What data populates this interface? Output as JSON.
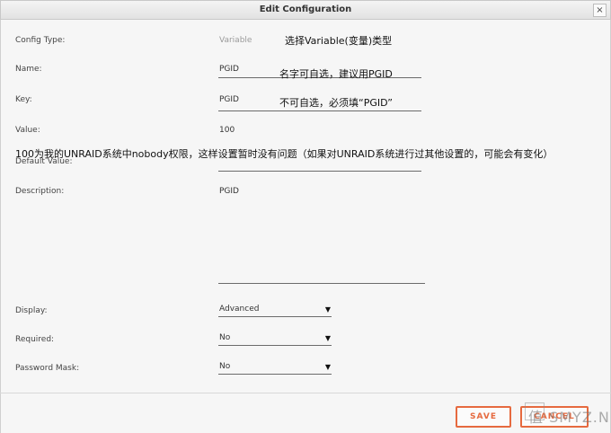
{
  "window": {
    "title": "Edit Configuration",
    "close_symbol": "×"
  },
  "fields": {
    "config_type": {
      "label": "Config Type:",
      "value": "Variable"
    },
    "name": {
      "label": "Name:",
      "value": "PGID"
    },
    "key": {
      "label": "Key:",
      "value": "PGID"
    },
    "value": {
      "label": "Value:",
      "value": "100"
    },
    "default_value": {
      "label": "Default Value:",
      "value": ""
    },
    "description": {
      "label": "Description:",
      "value": "PGID"
    },
    "display": {
      "label": "Display:",
      "value": "Advanced"
    },
    "required": {
      "label": "Required:",
      "value": "No"
    },
    "password_mask": {
      "label": "Password Mask:",
      "value": "No"
    }
  },
  "annotations": {
    "config_type_note": "选择Variable(变量)类型",
    "name_note": "名字可自选，建议用PGID",
    "key_note": "不可自选，必须填“PGID”",
    "value_note": "100为我的UNRAID系统中nobody权限，这样设置暂时没有问题（如果对UNRAID系统进行过其他设置的，可能会有变化）"
  },
  "buttons": {
    "save": "SAVE",
    "cancel": "CANCEL"
  },
  "watermark": "值 SMYZ.NET",
  "colors": {
    "accent": "#e66a3f",
    "background": "#f6f6f6"
  }
}
